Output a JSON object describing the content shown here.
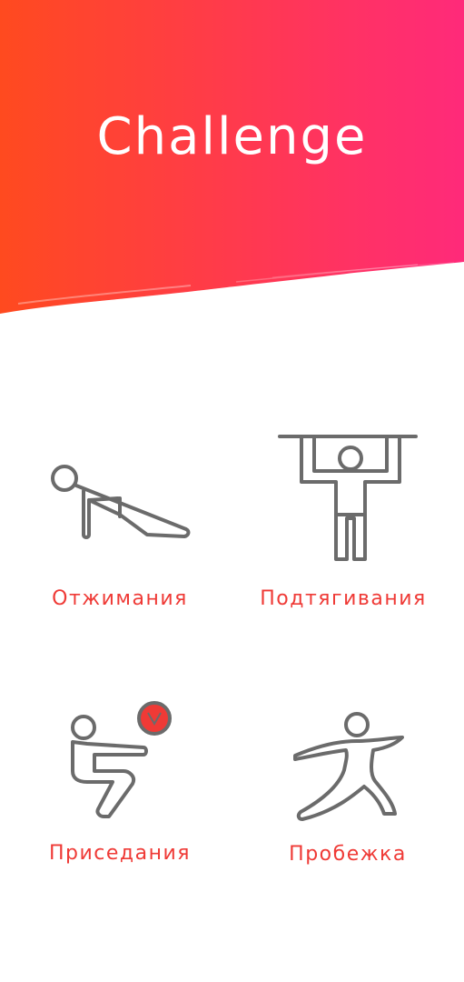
{
  "header": {
    "title": "Challenge",
    "gradient_start": "#ff4a1f",
    "gradient_end": "#ff2a7a"
  },
  "colors": {
    "label": "#ef3a36",
    "icon_stroke": "#6b6b6b"
  },
  "exercises": [
    {
      "label": "Отжимания",
      "icon": "pushup-icon"
    },
    {
      "label": "Подтягивания",
      "icon": "pullup-icon"
    },
    {
      "label": "Приседания",
      "icon": "squat-with-ball-icon"
    },
    {
      "label": "Пробежка",
      "icon": "running-icon"
    }
  ]
}
